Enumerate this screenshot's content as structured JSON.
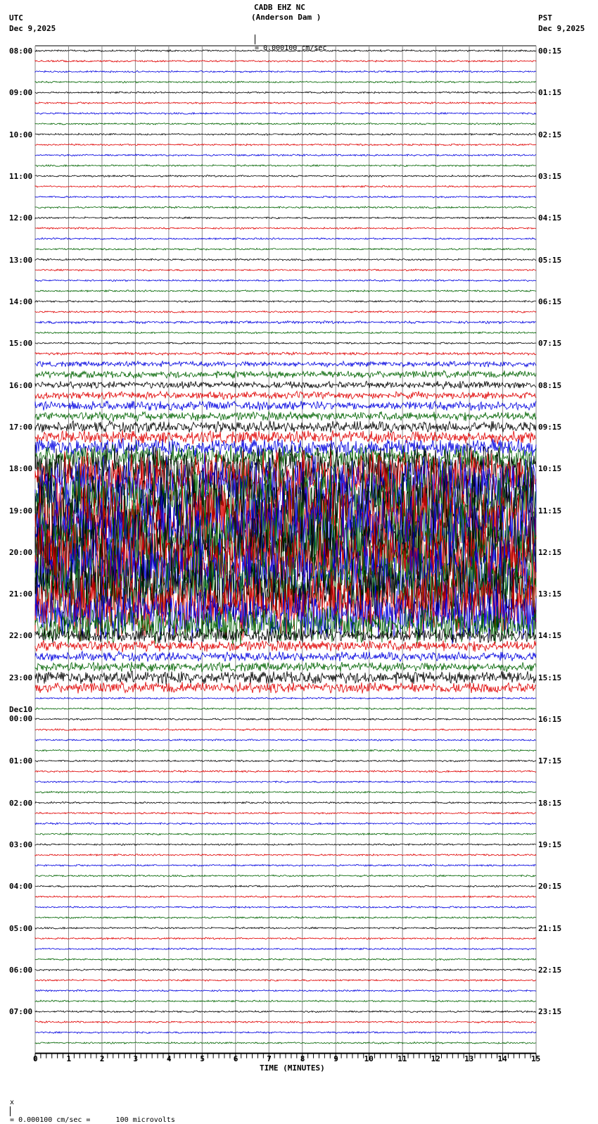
{
  "header": {
    "station": "CADB EHZ NC",
    "location": "(Anderson Dam )",
    "left_tz": "UTC",
    "left_date": "Dec 9,2025",
    "right_tz": "PST",
    "right_date": "Dec 9,2025",
    "scale": "= 0.000100 cm/sec"
  },
  "footer": {
    "scale": "= 0.000100 cm/sec =      100 microvolts",
    "prefix": "x"
  },
  "chart_data": {
    "type": "line",
    "title": "CADB EHZ NC (Anderson Dam )",
    "xlabel": "TIME (MINUTES)",
    "xlim": [
      0,
      15
    ],
    "x_ticks": [
      "0",
      "1",
      "2",
      "3",
      "4",
      "5",
      "6",
      "7",
      "8",
      "9",
      "10",
      "11",
      "12",
      "13",
      "14",
      "15"
    ],
    "trace_colors": [
      "#000000",
      "#e00000",
      "#0000e0",
      "#006400"
    ],
    "left_labels": [
      "08:00",
      "09:00",
      "10:00",
      "11:00",
      "12:00",
      "13:00",
      "14:00",
      "15:00",
      "16:00",
      "17:00",
      "18:00",
      "19:00",
      "20:00",
      "21:00",
      "22:00",
      "23:00",
      "Dec10\n00:00",
      "01:00",
      "02:00",
      "03:00",
      "04:00",
      "05:00",
      "06:00",
      "07:00"
    ],
    "right_labels": [
      "00:15",
      "01:15",
      "02:15",
      "03:15",
      "04:15",
      "05:15",
      "06:15",
      "07:15",
      "08:15",
      "09:15",
      "10:15",
      "11:15",
      "12:15",
      "13:15",
      "14:15",
      "15:15",
      "16:15",
      "17:15",
      "18:15",
      "19:15",
      "20:15",
      "21:15",
      "22:15",
      "23:15"
    ],
    "trace_amplitudes": [
      1,
      1,
      1,
      1,
      1,
      1,
      1,
      1,
      1,
      1,
      1,
      1,
      1,
      1,
      1,
      1,
      1,
      1,
      1,
      1,
      1,
      1,
      1,
      1,
      1,
      1,
      1.5,
      1,
      1,
      1.5,
      3,
      4,
      4,
      4,
      5,
      5,
      6,
      7,
      10,
      14,
      25,
      30,
      38,
      42,
      45,
      45,
      45,
      45,
      45,
      42,
      40,
      40,
      38,
      36,
      30,
      20,
      8,
      6,
      5,
      5,
      7,
      6,
      1,
      1,
      1,
      1,
      1,
      1,
      1,
      1,
      1,
      1,
      1,
      1,
      1,
      1,
      1,
      1,
      1,
      1,
      1,
      1,
      1,
      1,
      1,
      1,
      1,
      1,
      1,
      1,
      1,
      1,
      1,
      1,
      1,
      1
    ]
  }
}
